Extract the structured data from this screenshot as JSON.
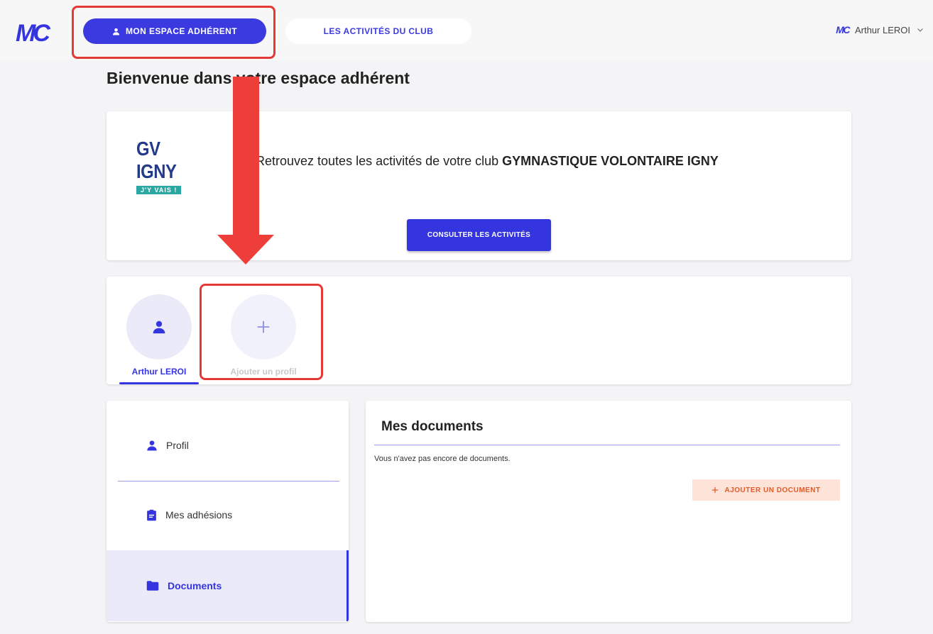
{
  "header": {
    "logo_text": "MC",
    "primary_tab": "MON ESPACE ADHÉRENT",
    "secondary_tab": "LES ACTIVITÉS DU CLUB",
    "user_logo": "MC",
    "user_name": "Arthur LEROI"
  },
  "page": {
    "title": "Bienvenue dans votre espace adhérent"
  },
  "club_card": {
    "logo_title": "GV IGNY",
    "logo_tagline": "J'Y VAIS !",
    "text_prefix": "Retrouvez toutes les activités de votre club ",
    "club_name": "GYMNASTIQUE VOLONTAIRE IGNY",
    "button": "CONSULTER LES ACTIVITÉS"
  },
  "profiles": {
    "current": "Arthur LEROI",
    "add_label": "Ajouter un profil"
  },
  "sidebar": {
    "items": [
      {
        "label": "Profil",
        "icon": "person-icon"
      },
      {
        "label": "Mes adhésions",
        "icon": "clipboard-icon"
      },
      {
        "label": "Documents",
        "icon": "folder-icon"
      }
    ]
  },
  "documents": {
    "title": "Mes documents",
    "empty_text": "Vous n'avez pas encore de documents.",
    "add_button": "AJOUTER UN DOCUMENT"
  },
  "colors": {
    "accent": "#3535e0",
    "annotation": "#ee3e3a",
    "add_doc_bg": "#fde3d8",
    "add_doc_text": "#e25b2b"
  }
}
